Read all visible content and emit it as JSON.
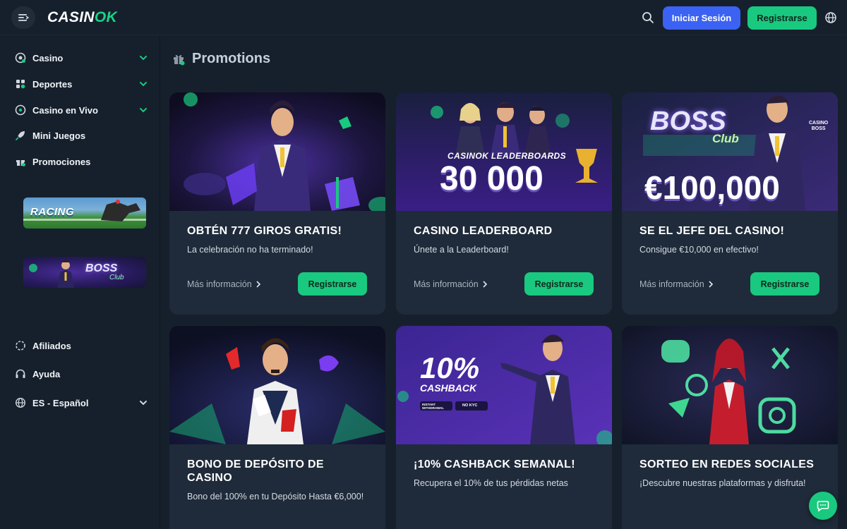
{
  "header": {
    "logo_main": "CASIN",
    "logo_accent": "OK",
    "login_label": "Iniciar Sesión",
    "register_label": "Registrarse"
  },
  "sidebar": {
    "items": [
      {
        "label": "Casino",
        "icon": "casino-chip-icon",
        "expandable": true
      },
      {
        "label": "Deportes",
        "icon": "sports-icon",
        "expandable": true
      },
      {
        "label": "Casino en Vivo",
        "icon": "live-casino-icon",
        "expandable": true
      },
      {
        "label": "Mini Juegos",
        "icon": "rocket-icon",
        "expandable": false
      },
      {
        "label": "Promociones",
        "icon": "gift-icon",
        "expandable": false
      }
    ],
    "banners": [
      {
        "label": "RACING"
      },
      {
        "label": "BOSS",
        "sub": "Club"
      }
    ],
    "footer_items": [
      {
        "label": "Afiliados",
        "icon": "affiliates-icon"
      },
      {
        "label": "Ayuda",
        "icon": "headset-icon"
      },
      {
        "label": "ES - Español",
        "icon": "globe-icon"
      }
    ]
  },
  "main": {
    "title": "Promotions",
    "cards": [
      {
        "title": "OBTÉN 777 GIROS GRATIS!",
        "desc": "La celebración no ha terminado!",
        "more": "Más información",
        "button": "Registrarse",
        "art": {}
      },
      {
        "title": "CASINO LEADERBOARD",
        "desc": "Únete a la Leaderboard!",
        "more": "Más información",
        "button": "Registrarse",
        "art": {
          "headline": "CASINOK LEADERBOARDS",
          "big": "30 000"
        }
      },
      {
        "title": "SE EL JEFE DEL CASINO!",
        "desc": "Consigue €10,000 en efectivo!",
        "more": "Más información",
        "button": "Registrarse",
        "art": {
          "headline": "BOSS",
          "sub": "Club",
          "big": "€100,000",
          "badge_top": "CASINO",
          "badge_bottom": "BOSS"
        }
      },
      {
        "title": "BONO DE DEPÓSITO DE CASINO",
        "desc": "Bono del 100% en tu Depósito Hasta €6,000!",
        "art": {}
      },
      {
        "title": "¡10% CASHBACK SEMANAL!",
        "desc": "Recupera el 10% de tus pérdidas netas",
        "art": {
          "big": "10%",
          "headline": "CASHBACK",
          "badge1": "INSTANT WITHDRAWAL",
          "badge2": "NO KYC"
        }
      },
      {
        "title": "SORTEO EN REDES SOCIALES",
        "desc": "¡Descubre nuestras plataformas y disfruta!",
        "art": {}
      }
    ]
  },
  "colors": {
    "background": "#16202c",
    "card": "#1f2b3a",
    "accent_green": "#19c97f",
    "login_blue": "#3b62f3"
  }
}
